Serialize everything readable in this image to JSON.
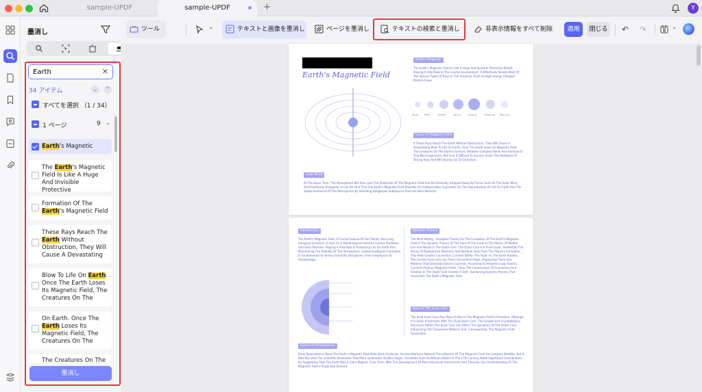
{
  "window": {
    "tabs": [
      "sample-UPDF",
      "sample-UPDF"
    ],
    "avatar": "Y"
  },
  "sidebar": {
    "title": "墨消し",
    "search_value": "Earth",
    "item_count": "34 アイテム",
    "select_all": "すべてを選択 （1 / 34）",
    "page_group": "1 ページ",
    "page_group_count": "9",
    "results": [
      {
        "pre": "",
        "hl": "Earth",
        "post": "'s Magnetic"
      },
      {
        "pre": "The ",
        "hl": "Earth",
        "post": "'s Magnetic Field Is Like A Huge And Invisible Protective"
      },
      {
        "pre": "Formation Of The ",
        "hl": "Earth",
        "post": "'s Magnetic Field"
      },
      {
        "pre": "These Rays Reach The ",
        "hl": "Earth",
        "post": " Without Obstruction, They Will Cause A Devastating"
      },
      {
        "pre": "Blow To Life On ",
        "hl": "Earth",
        "post": ". Once The Earth Loses Its Magnetic Field, The Creatures On The"
      },
      {
        "pre": "On Earth. Once The ",
        "hl": "Earth",
        "post": " Loses Its Magnetic Field, The Creatures On The"
      },
      {
        "pre": "The Creatures On The",
        "hl": "",
        "post": ""
      }
    ],
    "redact_button": "墨消し"
  },
  "toolbar": {
    "tool": "ツール",
    "redact_text_images": "テキストと画像を墨消し",
    "redact_page": "ページを墨消し",
    "search_redact": "テキストの検索と墨消し",
    "remove_hidden": "非表示情報をすべて削除",
    "apply": "適用",
    "close": "閉じる"
  },
  "document": {
    "page1": {
      "title": "Earth's Magnetic Field",
      "label_magnetic": "Earth's Magnetic",
      "label_loses": "Loses Its Magnetic Field",
      "label_solar": "Solar Wind",
      "planets": [
        "Earth",
        "Mars",
        "Jupiter",
        "Saturn",
        "Uranus",
        "Neptune",
        "Mercury"
      ],
      "text_a": "The Earth's Magnetic Field Is Like A Huge And Invisible Protective Shield, Playing A Vital Role In The Cosmic Environment. It Effectively Resists Most Of The Various Types Of Rays In The Universe, Such As High-energy Charged Particle Flows.",
      "text_b": "If These Rays Reach The Earth Without Obstruction, They Will Cause A Devastating Blow To Life On Earth. Once The Earth Loses Its Magnetic Field, The Creatures On The Earth's Surface, Whether Complex Plants And Animals Or Tiny Microorganisms, Will Find It Difficult To Survive Under The Radiation Of Strong Rays And Will Quickly Go To Extinction.",
      "text_c": "At The Same Time, The Atmosphere Will Also Lose The Protection Of The Magnetic Field And Be Gradually Stripped Away By Forces Such As The Solar Wind, And Eventually Disappear. It Can Be Said That The Earth's Magnetic Field Provides An Indispensable Guarantee For The Reproduction Of Life On Earth And The Stable Existence Of The Atmosphere By Shielding Dangerous Substances Such As Solar Particles."
    },
    "page2": {
      "label_intro": "Introduction",
      "label_dynamo": "Dynamo Theory",
      "label_inner": "Role Of The Inner Core",
      "label_hist": "Historical Perspectives",
      "text_intro": "The Earth's Magnetic Field, A Crucial Feature Of Our Planet, Has Long Intrigued Scientists. It Acts As A Shield Against Harmful Cosmic Radiation And Solar Particles, Playing A Vital Role In Protecting Life On Earth And Maintaining The Stability Of The Atmosphere. Understanding Its Formation Is Fundamental To Various Scientific Disciplines, From Geophysics To Astrobiology.",
      "text_dynamo": "The Most Widely - Accepted Theory For The Formation Of The Earth's Magnetic Field Is The Dynamo Theory. At The Core Of The Earth Is The Motion Of Molten Iron And Nickel In The Outer Core. The Outer Core Is A Fluid Layer, Heated By The Decay Of Radioactive Elements And Residual Heat From The Planet's Formation. This Heat Creates Convection Currents Within The Fluid. As The Earth Rotates, The Coriolis Force Acts On These Convective Flows, Organizing Them Into Patterns That Generate Electric Currents. According To Ampere's Law, Electric Currents Produce Magnetic Fields. Thus, The Combination Of Convection And Rotation In The Outer Core Creates A Self - Sustaining Dynamo Process That Generates The Earth's Magnetic Field.",
      "text_inner": "The Solid Inner Core Also Plays A Role In The Magnetic Field's Formation. Although It Is Solid, It Interacts With The Fluid Outer Core. The Growth And Crystallization Processes Within The Inner Core Can Affect The Dynamics Of The Outer Core, Influencing The Convective Patterns And, Consequently, The Magnetic Field Generation.",
      "text_hist": "Early Speculations About The Earth's Magnetic Field Date Back Centuries. Ancient Mariners Noticed The Influence Of The Magnetic Field On Compass Needles, But It Was Not Until The Scientific Revolution That More Systematic Studies Began. Scientists Such As William Gilbert In The 17th Century Made Significant Contributions By Suggesting That The Earth Was A Giant Magnet. Over Time, With The Development Of More Advanced Instruments And Theories, Our Understanding Of The Magnetic Field's Origin Has Evolved."
    }
  }
}
